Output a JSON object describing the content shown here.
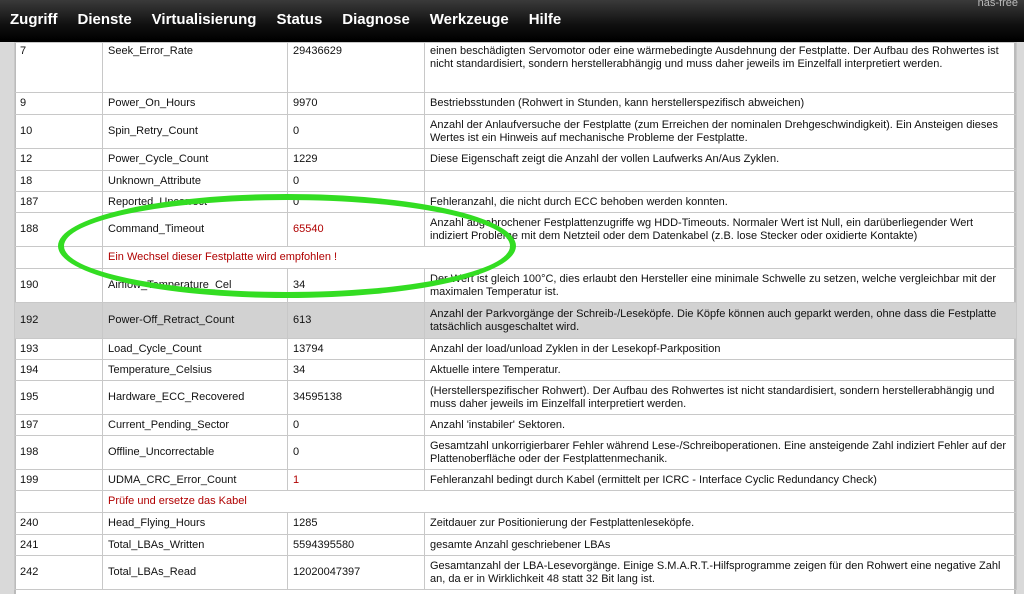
{
  "topbar": {
    "nav": [
      "Zugriff",
      "Dienste",
      "Virtualisierung",
      "Status",
      "Diagnose",
      "Werkzeuge",
      "Hilfe"
    ],
    "hostname": "nas-free"
  },
  "smart_table": {
    "rows": [
      {
        "id": "7",
        "attr": "Seek_Error_Rate",
        "value": "29436629",
        "desc": "einen beschädigten Servomotor oder eine wärmebedingte Ausdehnung der Festplatte. Der Aufbau des Rohwertes ist nicht standardisiert, sondern herstellerabhängig und muss daher jeweils im Einzelfall interpretiert werden."
      },
      {
        "id": "9",
        "attr": "Power_On_Hours",
        "value": "9970",
        "desc": "Bestriebsstunden (Rohwert in Stunden, kann herstellerspezifisch abweichen)"
      },
      {
        "id": "10",
        "attr": "Spin_Retry_Count",
        "value": "0",
        "desc": "Anzahl der Anlaufversuche der Festplatte (zum Erreichen der nominalen Drehgeschwindigkeit). Ein Ansteigen dieses Wertes ist ein Hinweis auf mechanische Probleme der Festplatte."
      },
      {
        "id": "12",
        "attr": "Power_Cycle_Count",
        "value": "1229",
        "desc": "Diese Eigenschaft zeigt die Anzahl der vollen Laufwerks An/Aus Zyklen."
      },
      {
        "id": "18",
        "attr": "Unknown_Attribute",
        "value": "0",
        "desc": ""
      },
      {
        "id": "187",
        "attr": "Reported_Uncorrect",
        "value": "0",
        "desc": "Fehleranzahl, die nicht durch ECC behoben werden konnten."
      },
      {
        "id": "188",
        "attr": "Command_Timeout",
        "value": "65540",
        "desc": "Anzahl abgebrochener Festplattenzugriffe wg HDD-Timeouts. Normaler Wert ist Null, ein darüberliegender Wert indiziert Probleme mit dem Netzteil oder dem Datenkabel (z.B. lose Stecker oder oxidierte Kontakte)"
      },
      {
        "id": "190",
        "attr": "Airflow_Temperature_Cel",
        "value": "34",
        "desc": "Der Wert ist gleich 100°C, dies erlaubt den Hersteller eine minimale Schwelle zu setzen, welche vergleichbar mit der maximalen Temperatur ist."
      },
      {
        "id": "192",
        "attr": "Power-Off_Retract_Count",
        "value": "613",
        "desc": "Anzahl der Parkvorgänge der Schreib-/Leseköpfe. Die Köpfe können auch geparkt werden, ohne dass die Festplatte tatsächlich ausgeschaltet wird."
      },
      {
        "id": "193",
        "attr": "Load_Cycle_Count",
        "value": "13794",
        "desc": "Anzahl der load/unload Zyklen in der Lesekopf-Parkposition"
      },
      {
        "id": "194",
        "attr": "Temperature_Celsius",
        "value": "34",
        "desc": "Aktuelle intere Temperatur."
      },
      {
        "id": "195",
        "attr": "Hardware_ECC_Recovered",
        "value": "34595138",
        "desc": "(Herstellerspezifischer Rohwert). Der Aufbau des Rohwertes ist nicht standardisiert, sondern herstellerabhängig und muss daher jeweils im Einzelfall interpretiert werden."
      },
      {
        "id": "197",
        "attr": "Current_Pending_Sector",
        "value": "0",
        "desc": "Anzahl 'instabiler' Sektoren."
      },
      {
        "id": "198",
        "attr": "Offline_Uncorrectable",
        "value": "0",
        "desc": "Gesamtzahl unkorrigierbarer Fehler während Lese-/Schreiboperationen. Eine ansteigende Zahl indiziert Fehler auf der Plattenoberfläche oder der Festplattenmechanik."
      },
      {
        "id": "199",
        "attr": "UDMA_CRC_Error_Count",
        "value": "1",
        "desc": "Fehleranzahl bedingt durch Kabel (ermittelt per ICRC - Interface Cyclic Redundancy Check)"
      },
      {
        "id": "240",
        "attr": "Head_Flying_Hours",
        "value": "1285",
        "desc": "Zeitdauer zur Positionierung der Festplattenleseköpfe."
      },
      {
        "id": "241",
        "attr": "Total_LBAs_Written",
        "value": "5594395580",
        "desc": "gesamte Anzahl geschriebener LBAs"
      },
      {
        "id": "242",
        "attr": "Total_LBAs_Read",
        "value": "12020047397",
        "desc": "Gesamtanzahl der LBA-Lesevorgänge. Einige S.M.A.R.T.-Hilfsprogramme zeigen für den Rohwert eine negative Zahl an, da er in Wirklichkeit 48 statt 32 Bit lang ist."
      }
    ],
    "warnings": {
      "command_timeout": "Ein Wechsel dieser Festplatte wird empfohlen !",
      "udma_crc": "Prüfe und ersetze das Kabel"
    }
  },
  "colors": {
    "warning_red": "#b00000",
    "highlight_ellipse": "#33dd22",
    "shaded_row": "#d2d2d2"
  }
}
